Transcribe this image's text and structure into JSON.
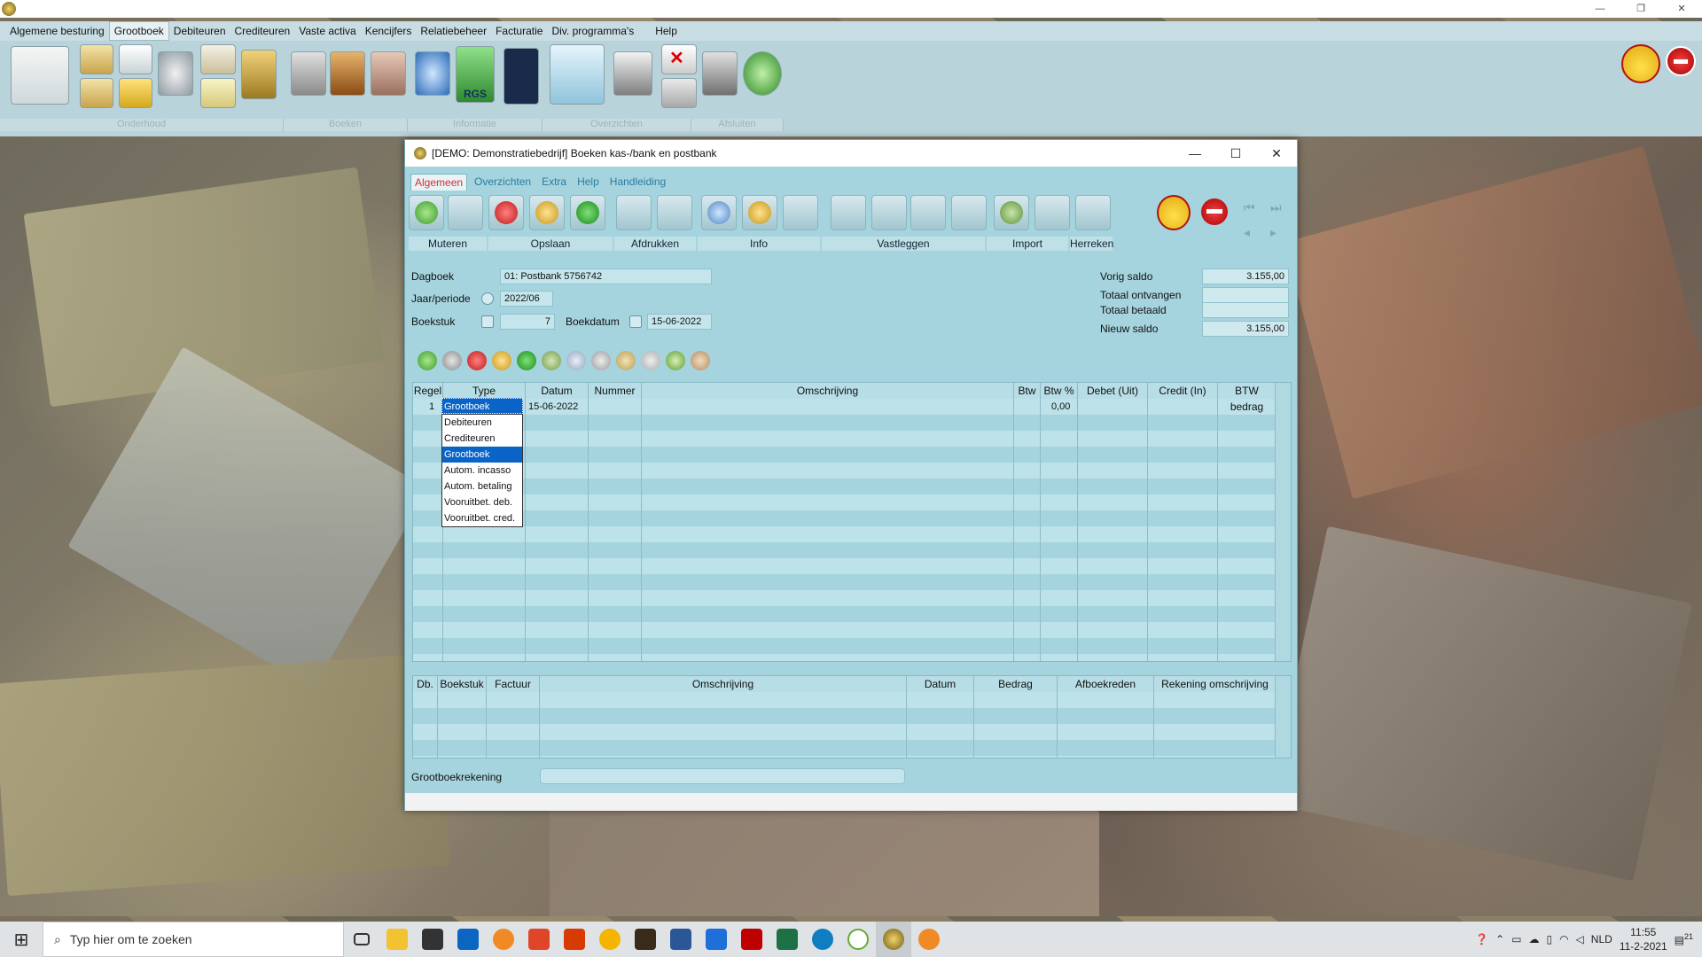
{
  "menu": {
    "items": [
      "Algemene besturing",
      "Grootboek",
      "Debiteuren",
      "Crediteuren",
      "Vaste activa",
      "Kencijfers",
      "Relatiebeheer",
      "Facturatie",
      "Div. programma's",
      "Help"
    ],
    "active": "Grootboek"
  },
  "toolbar": {
    "group_labels": [
      "Onderhoud",
      "Boeken",
      "Informatie",
      "Overzichten",
      "Afsluiten"
    ],
    "rgs_label": "RGS"
  },
  "dialog": {
    "title": "[DEMO: Demonstratiebedrijf]  Boeken kas-/bank en postbank",
    "tabs": [
      "Algemeen",
      "Overzichten",
      "Extra",
      "Help",
      "Handleiding"
    ],
    "active_tab": "Algemeen",
    "button_groups": [
      "Muteren",
      "Opslaan",
      "Afdrukken",
      "Info",
      "Vastleggen",
      "Import",
      "Herreken"
    ],
    "form": {
      "dagboek_label": "Dagboek",
      "dagboek_value": "01: Postbank 5756742",
      "jaar_label": "Jaar/periode",
      "jaar_value": "2022/06",
      "boekstuk_label": "Boekstuk",
      "boekstuk_value": "7",
      "boekdatum_label": "Boekdatum",
      "boekdatum_value": "15-06-2022"
    },
    "saldo": {
      "vorig_label": "Vorig saldo",
      "vorig_value": "3.155,00",
      "ontvangen_label": "Totaal ontvangen",
      "ontvangen_value": "",
      "betaald_label": "Totaal betaald",
      "betaald_value": "",
      "nieuw_label": "Nieuw saldo",
      "nieuw_value": "3.155,00"
    },
    "grid1": {
      "headers": [
        "Regel",
        "Type",
        "Datum",
        "Nummer",
        "Omschrijving",
        "Btw",
        "Btw %",
        "Debet (Uit)",
        "Credit (In)",
        "BTW bedrag"
      ],
      "rows": [
        {
          "regel": "1",
          "type": "Grootboek",
          "datum": "15-06-2022",
          "nummer": "",
          "omschrijving": "",
          "btw": "",
          "btwpct": "0,00",
          "debet": "",
          "credit": "",
          "btwbedrag": ""
        }
      ],
      "type_options": [
        "Debiteuren",
        "Crediteuren",
        "Grootboek",
        "Autom. incasso",
        "Autom. betaling",
        "Vooruitbet. deb.",
        "Vooruitbet. cred."
      ],
      "type_selected": "Grootboek"
    },
    "grid2": {
      "headers": [
        "Db.",
        "Boekstuk",
        "Factuur",
        "Omschrijving",
        "Datum",
        "Bedrag",
        "Afboekreden",
        "Rekening omschrijving"
      ]
    },
    "footer": {
      "label": "Grootboekrekening",
      "value": ""
    }
  },
  "taskbar": {
    "search_placeholder": "Typ hier om te zoeken",
    "language": "NLD",
    "time": "11:55",
    "date": "11-2-2021",
    "notification_count": "21"
  }
}
